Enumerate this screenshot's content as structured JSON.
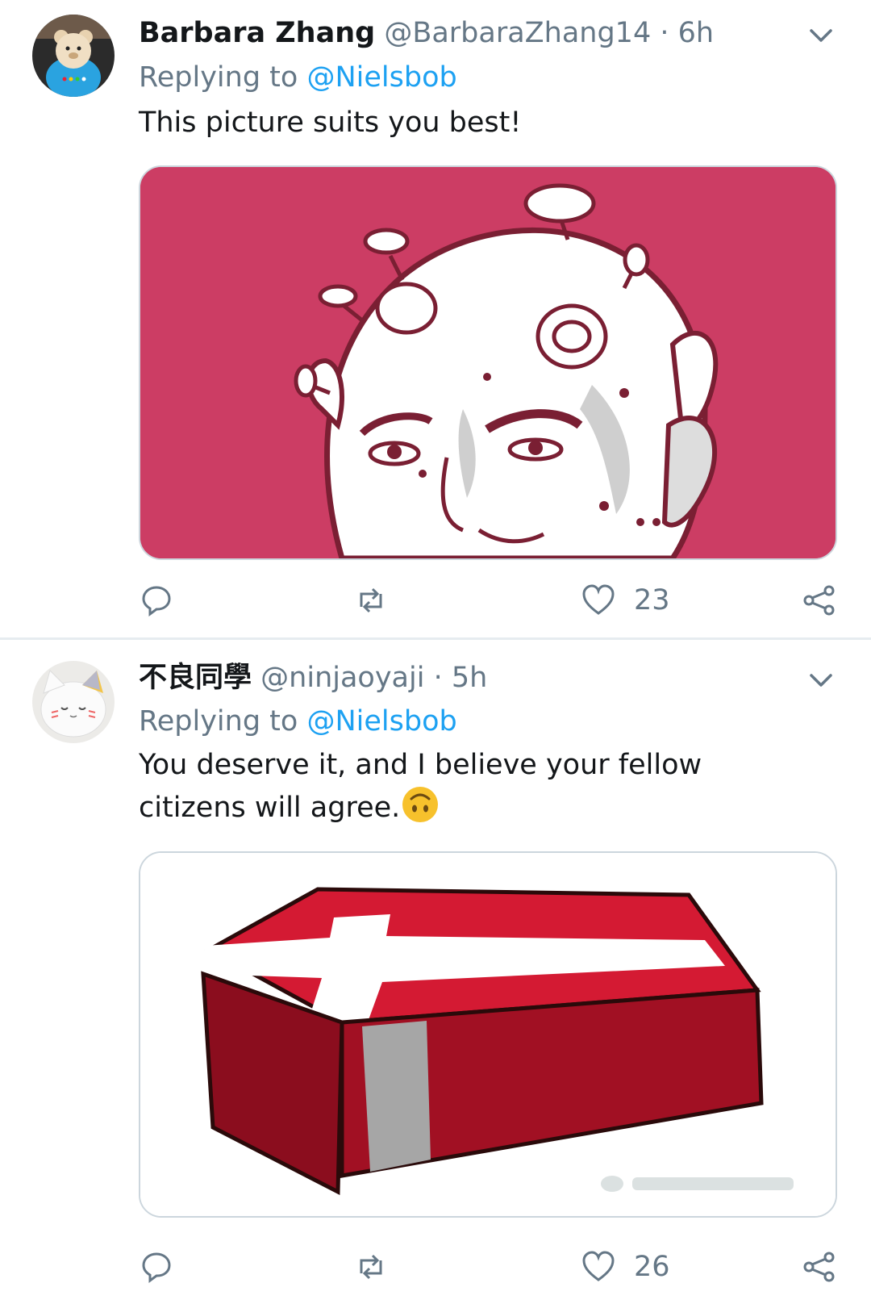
{
  "tweets": [
    {
      "display_name": "Barbara Zhang",
      "handle": "@BarbaraZhang14",
      "separator": "·",
      "time": "6h",
      "replying_to_label": "Replying to",
      "replying_to_handle": "@Nielsbob",
      "text": "This picture suits you best!",
      "like_count": "23",
      "avatar_icon": "teddy-bear-avatar",
      "media_description_icon": "virus-head-illustration"
    },
    {
      "display_name": "不良同學",
      "handle": "@ninjaoyaji",
      "separator": "·",
      "time": "5h",
      "replying_to_label": "Replying to",
      "replying_to_handle": "@Nielsbob",
      "text": "You deserve it, and I believe your fellow citizens will agree.",
      "like_count": "26",
      "avatar_icon": "cat-avatar",
      "media_description_icon": "danish-flag-coffin-illustration"
    }
  ],
  "colors": {
    "accent": "#1da1f2",
    "secondary_text": "#657786",
    "media_pink": "#cc3d64",
    "flag_red": "#c8102e"
  }
}
